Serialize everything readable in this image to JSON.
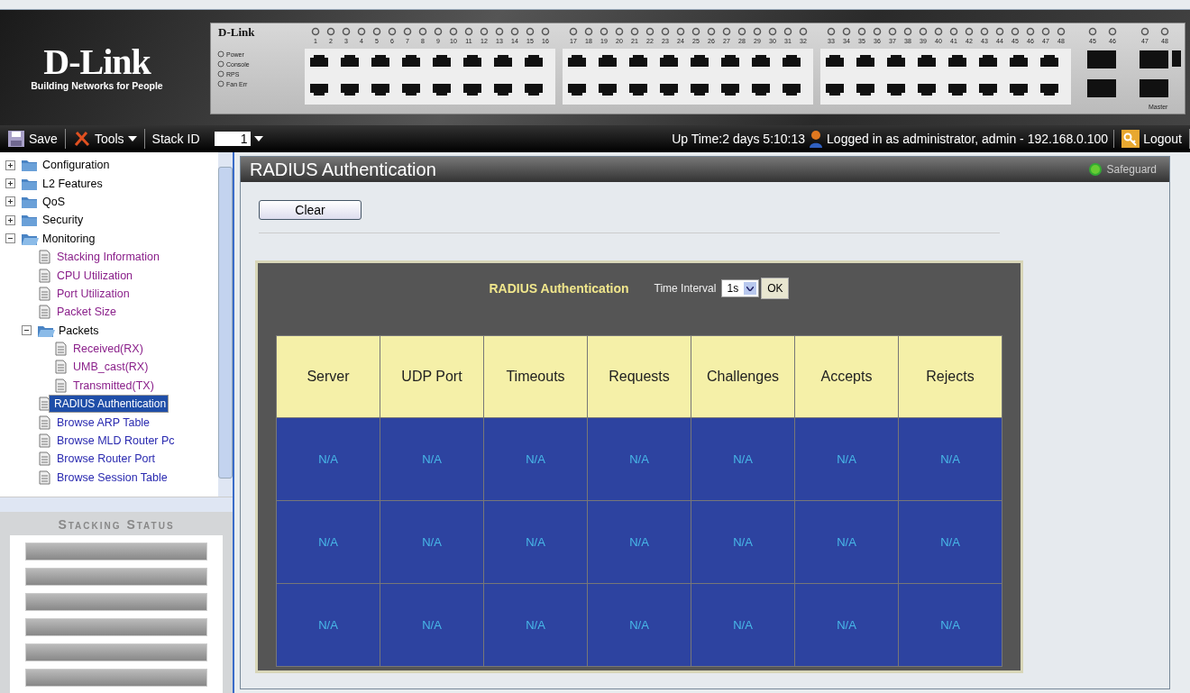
{
  "banner": {
    "logo": "D-Link",
    "tagline": "Building Networks for People",
    "device": {
      "brand": "D-Link",
      "leds": [
        "Power",
        "Console",
        "RPS",
        "Fan Err"
      ],
      "port_groups": [
        [
          "1",
          "2",
          "3",
          "4",
          "5",
          "6",
          "7",
          "8",
          "9",
          "10",
          "11",
          "12",
          "13",
          "14",
          "15",
          "16"
        ],
        [
          "17",
          "18",
          "19",
          "20",
          "21",
          "22",
          "23",
          "24",
          "25",
          "26",
          "27",
          "28",
          "29",
          "30",
          "31",
          "32"
        ],
        [
          "33",
          "34",
          "35",
          "36",
          "37",
          "38",
          "39",
          "40",
          "41",
          "42",
          "43",
          "44",
          "45",
          "46",
          "47",
          "48"
        ]
      ],
      "combo_ports": [
        "45",
        "46",
        "47",
        "48"
      ],
      "master_label": "Master"
    }
  },
  "toolbar": {
    "save": "Save",
    "tools": "Tools",
    "stack_id_label": "Stack ID",
    "stack_id": "1",
    "uptime": "Up Time:2 days 5:10:13",
    "login": "Logged in as administrator, admin - 192.168.0.100",
    "logout": "Logout"
  },
  "tree": [
    {
      "label": "Configuration",
      "kind": "folder",
      "expanded": false,
      "selected": false
    },
    {
      "label": "L2 Features",
      "kind": "folder",
      "expanded": false,
      "selected": false
    },
    {
      "label": "QoS",
      "kind": "folder",
      "expanded": false,
      "selected": false
    },
    {
      "label": "Security",
      "kind": "folder",
      "expanded": false,
      "selected": false
    },
    {
      "label": "Monitoring",
      "kind": "folder",
      "expanded": true,
      "selected": false,
      "children": [
        {
          "label": "Stacking Information",
          "kind": "page",
          "visited": true,
          "selected": false
        },
        {
          "label": "CPU Utilization",
          "kind": "page",
          "visited": true,
          "selected": false
        },
        {
          "label": "Port Utilization",
          "kind": "page",
          "visited": true,
          "selected": false
        },
        {
          "label": "Packet Size",
          "kind": "page",
          "visited": true,
          "selected": false
        },
        {
          "label": "Packets",
          "kind": "folder",
          "expanded": true,
          "selected": false,
          "children": [
            {
              "label": "Received(RX)",
              "kind": "page",
              "visited": true,
              "selected": false
            },
            {
              "label": "UMB_cast(RX)",
              "kind": "page",
              "visited": true,
              "selected": false
            },
            {
              "label": "Transmitted(TX)",
              "kind": "page",
              "visited": true,
              "selected": false
            }
          ]
        },
        {
          "label": "RADIUS Authentication",
          "kind": "page",
          "visited": false,
          "selected": true
        },
        {
          "label": "Browse ARP Table",
          "kind": "page",
          "visited": false,
          "selected": false
        },
        {
          "label": "Browse MLD Router Pc",
          "kind": "page",
          "visited": false,
          "selected": false
        },
        {
          "label": "Browse Router Port",
          "kind": "page",
          "visited": false,
          "selected": false
        },
        {
          "label": "Browse Session Table",
          "kind": "page",
          "visited": false,
          "selected": false
        }
      ]
    }
  ],
  "stacking_status": {
    "title": "Stacking Status"
  },
  "panel": {
    "title": "RADIUS Authentication",
    "safeguard": "Safeguard",
    "clear_button": "Clear",
    "stats": {
      "title": "RADIUS Authentication",
      "interval_label": "Time Interval",
      "interval": "1s",
      "ok_button": "OK",
      "columns": [
        "Server",
        "UDP Port",
        "Timeouts",
        "Requests",
        "Challenges",
        "Accepts",
        "Rejects"
      ],
      "rows": [
        [
          "N/A",
          "N/A",
          "N/A",
          "N/A",
          "N/A",
          "N/A",
          "N/A"
        ],
        [
          "N/A",
          "N/A",
          "N/A",
          "N/A",
          "N/A",
          "N/A",
          "N/A"
        ],
        [
          "N/A",
          "N/A",
          "N/A",
          "N/A",
          "N/A",
          "N/A",
          "N/A"
        ]
      ]
    }
  }
}
